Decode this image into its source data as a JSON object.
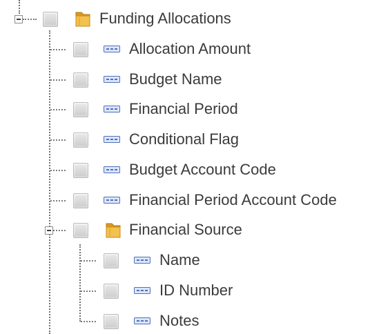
{
  "tree": {
    "root": {
      "label": "Funding Allocations",
      "icon": "folder-icon",
      "children": [
        {
          "label": "Allocation Amount",
          "icon": "field-icon"
        },
        {
          "label": "Budget Name",
          "icon": "field-icon"
        },
        {
          "label": "Financial Period",
          "icon": "field-icon"
        },
        {
          "label": "Conditional Flag",
          "icon": "field-icon"
        },
        {
          "label": "Budget Account Code",
          "icon": "field-icon"
        },
        {
          "label": "Financial Period Account Code",
          "icon": "field-icon"
        },
        {
          "label": "Financial Source",
          "icon": "folder-icon",
          "children": [
            {
              "label": "Name",
              "icon": "field-icon"
            },
            {
              "label": "ID Number",
              "icon": "field-icon"
            },
            {
              "label": "Notes",
              "icon": "field-icon"
            }
          ]
        }
      ]
    }
  },
  "colors": {
    "text": "#3b3b3b",
    "folder": "#e8b23a",
    "field": "#4f6fb8",
    "guide": "#6f6f6f"
  }
}
